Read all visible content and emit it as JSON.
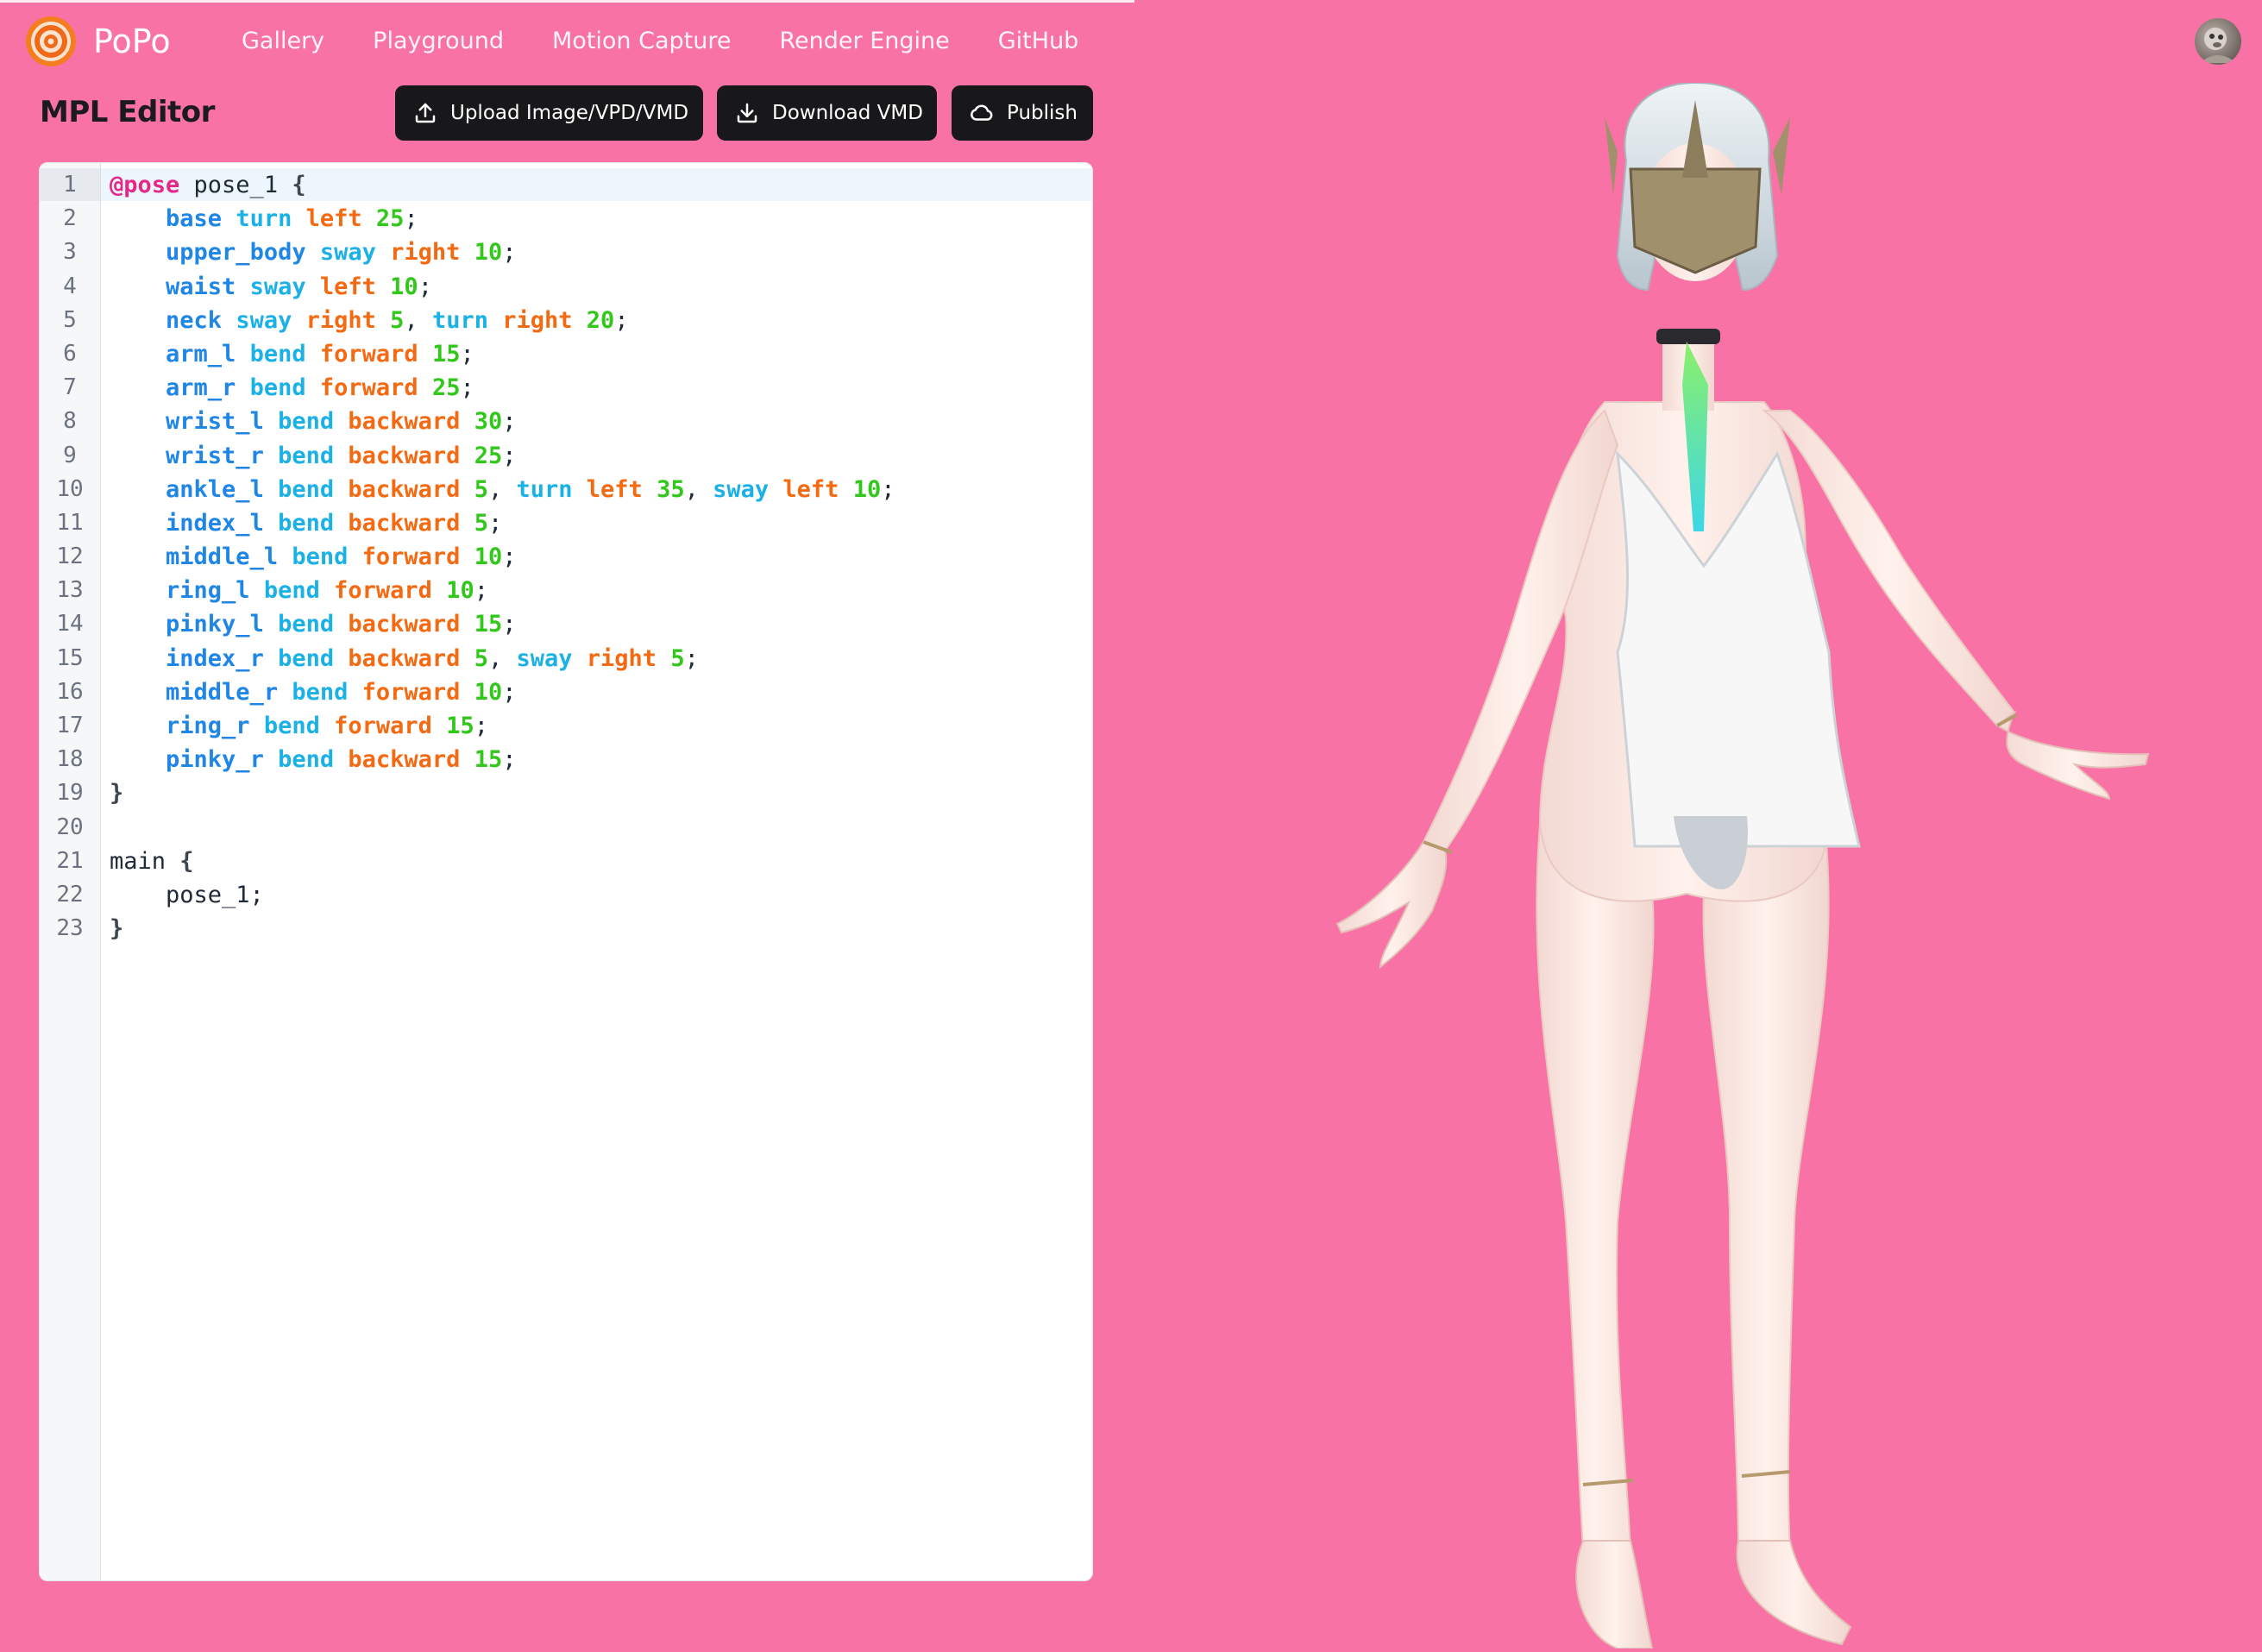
{
  "nav": {
    "brand": "PoPo",
    "links": [
      "Gallery",
      "Playground",
      "Motion Capture",
      "Render Engine",
      "GitHub"
    ]
  },
  "editor": {
    "title": "MPL Editor",
    "buttons": {
      "upload": "Upload Image/VPD/VMD",
      "download": "Download VMD",
      "publish": "Publish"
    },
    "line_numbers": [
      "1",
      "2",
      "3",
      "4",
      "5",
      "6",
      "7",
      "8",
      "9",
      "10",
      "11",
      "12",
      "13",
      "14",
      "15",
      "16",
      "17",
      "18",
      "19",
      "20",
      "21",
      "22",
      "23"
    ],
    "code_lines": [
      [
        [
          "kw-at",
          "@pose"
        ],
        [
          "plain",
          " pose_1 "
        ],
        [
          "brace",
          "{"
        ]
      ],
      [
        [
          "plain",
          "    "
        ],
        [
          "bone",
          "base"
        ],
        [
          "plain",
          " "
        ],
        [
          "act",
          "turn"
        ],
        [
          "plain",
          " "
        ],
        [
          "dir",
          "left"
        ],
        [
          "plain",
          " "
        ],
        [
          "num",
          "25"
        ],
        [
          "plain",
          ";"
        ]
      ],
      [
        [
          "plain",
          "    "
        ],
        [
          "bone",
          "upper_body"
        ],
        [
          "plain",
          " "
        ],
        [
          "act",
          "sway"
        ],
        [
          "plain",
          " "
        ],
        [
          "dir",
          "right"
        ],
        [
          "plain",
          " "
        ],
        [
          "num",
          "10"
        ],
        [
          "plain",
          ";"
        ]
      ],
      [
        [
          "plain",
          "    "
        ],
        [
          "bone",
          "waist"
        ],
        [
          "plain",
          " "
        ],
        [
          "act",
          "sway"
        ],
        [
          "plain",
          " "
        ],
        [
          "dir",
          "left"
        ],
        [
          "plain",
          " "
        ],
        [
          "num",
          "10"
        ],
        [
          "plain",
          ";"
        ]
      ],
      [
        [
          "plain",
          "    "
        ],
        [
          "bone",
          "neck"
        ],
        [
          "plain",
          " "
        ],
        [
          "act",
          "sway"
        ],
        [
          "plain",
          " "
        ],
        [
          "dir",
          "right"
        ],
        [
          "plain",
          " "
        ],
        [
          "num",
          "5"
        ],
        [
          "plain",
          ", "
        ],
        [
          "act",
          "turn"
        ],
        [
          "plain",
          " "
        ],
        [
          "dir",
          "right"
        ],
        [
          "plain",
          " "
        ],
        [
          "num",
          "20"
        ],
        [
          "plain",
          ";"
        ]
      ],
      [
        [
          "plain",
          "    "
        ],
        [
          "bone",
          "arm_l"
        ],
        [
          "plain",
          " "
        ],
        [
          "act",
          "bend"
        ],
        [
          "plain",
          " "
        ],
        [
          "dir",
          "forward"
        ],
        [
          "plain",
          " "
        ],
        [
          "num",
          "15"
        ],
        [
          "plain",
          ";"
        ]
      ],
      [
        [
          "plain",
          "    "
        ],
        [
          "bone",
          "arm_r"
        ],
        [
          "plain",
          " "
        ],
        [
          "act",
          "bend"
        ],
        [
          "plain",
          " "
        ],
        [
          "dir",
          "forward"
        ],
        [
          "plain",
          " "
        ],
        [
          "num",
          "25"
        ],
        [
          "plain",
          ";"
        ]
      ],
      [
        [
          "plain",
          "    "
        ],
        [
          "bone",
          "wrist_l"
        ],
        [
          "plain",
          " "
        ],
        [
          "act",
          "bend"
        ],
        [
          "plain",
          " "
        ],
        [
          "dir",
          "backward"
        ],
        [
          "plain",
          " "
        ],
        [
          "num",
          "30"
        ],
        [
          "plain",
          ";"
        ]
      ],
      [
        [
          "plain",
          "    "
        ],
        [
          "bone",
          "wrist_r"
        ],
        [
          "plain",
          " "
        ],
        [
          "act",
          "bend"
        ],
        [
          "plain",
          " "
        ],
        [
          "dir",
          "backward"
        ],
        [
          "plain",
          " "
        ],
        [
          "num",
          "25"
        ],
        [
          "plain",
          ";"
        ]
      ],
      [
        [
          "plain",
          "    "
        ],
        [
          "bone",
          "ankle_l"
        ],
        [
          "plain",
          " "
        ],
        [
          "act",
          "bend"
        ],
        [
          "plain",
          " "
        ],
        [
          "dir",
          "backward"
        ],
        [
          "plain",
          " "
        ],
        [
          "num",
          "5"
        ],
        [
          "plain",
          ", "
        ],
        [
          "act",
          "turn"
        ],
        [
          "plain",
          " "
        ],
        [
          "dir",
          "left"
        ],
        [
          "plain",
          " "
        ],
        [
          "num",
          "35"
        ],
        [
          "plain",
          ", "
        ],
        [
          "act",
          "sway"
        ],
        [
          "plain",
          " "
        ],
        [
          "dir",
          "left"
        ],
        [
          "plain",
          " "
        ],
        [
          "num",
          "10"
        ],
        [
          "plain",
          ";"
        ]
      ],
      [
        [
          "plain",
          "    "
        ],
        [
          "bone",
          "index_l"
        ],
        [
          "plain",
          " "
        ],
        [
          "act",
          "bend"
        ],
        [
          "plain",
          " "
        ],
        [
          "dir",
          "backward"
        ],
        [
          "plain",
          " "
        ],
        [
          "num",
          "5"
        ],
        [
          "plain",
          ";"
        ]
      ],
      [
        [
          "plain",
          "    "
        ],
        [
          "bone",
          "middle_l"
        ],
        [
          "plain",
          " "
        ],
        [
          "act",
          "bend"
        ],
        [
          "plain",
          " "
        ],
        [
          "dir",
          "forward"
        ],
        [
          "plain",
          " "
        ],
        [
          "num",
          "10"
        ],
        [
          "plain",
          ";"
        ]
      ],
      [
        [
          "plain",
          "    "
        ],
        [
          "bone",
          "ring_l"
        ],
        [
          "plain",
          " "
        ],
        [
          "act",
          "bend"
        ],
        [
          "plain",
          " "
        ],
        [
          "dir",
          "forward"
        ],
        [
          "plain",
          " "
        ],
        [
          "num",
          "10"
        ],
        [
          "plain",
          ";"
        ]
      ],
      [
        [
          "plain",
          "    "
        ],
        [
          "bone",
          "pinky_l"
        ],
        [
          "plain",
          " "
        ],
        [
          "act",
          "bend"
        ],
        [
          "plain",
          " "
        ],
        [
          "dir",
          "backward"
        ],
        [
          "plain",
          " "
        ],
        [
          "num",
          "15"
        ],
        [
          "plain",
          ";"
        ]
      ],
      [
        [
          "plain",
          "    "
        ],
        [
          "bone",
          "index_r"
        ],
        [
          "plain",
          " "
        ],
        [
          "act",
          "bend"
        ],
        [
          "plain",
          " "
        ],
        [
          "dir",
          "backward"
        ],
        [
          "plain",
          " "
        ],
        [
          "num",
          "5"
        ],
        [
          "plain",
          ", "
        ],
        [
          "act",
          "sway"
        ],
        [
          "plain",
          " "
        ],
        [
          "dir",
          "right"
        ],
        [
          "plain",
          " "
        ],
        [
          "num",
          "5"
        ],
        [
          "plain",
          ";"
        ]
      ],
      [
        [
          "plain",
          "    "
        ],
        [
          "bone",
          "middle_r"
        ],
        [
          "plain",
          " "
        ],
        [
          "act",
          "bend"
        ],
        [
          "plain",
          " "
        ],
        [
          "dir",
          "forward"
        ],
        [
          "plain",
          " "
        ],
        [
          "num",
          "10"
        ],
        [
          "plain",
          ";"
        ]
      ],
      [
        [
          "plain",
          "    "
        ],
        [
          "bone",
          "ring_r"
        ],
        [
          "plain",
          " "
        ],
        [
          "act",
          "bend"
        ],
        [
          "plain",
          " "
        ],
        [
          "dir",
          "forward"
        ],
        [
          "plain",
          " "
        ],
        [
          "num",
          "15"
        ],
        [
          "plain",
          ";"
        ]
      ],
      [
        [
          "plain",
          "    "
        ],
        [
          "bone",
          "pinky_r"
        ],
        [
          "plain",
          " "
        ],
        [
          "act",
          "bend"
        ],
        [
          "plain",
          " "
        ],
        [
          "dir",
          "backward"
        ],
        [
          "plain",
          " "
        ],
        [
          "num",
          "15"
        ],
        [
          "plain",
          ";"
        ]
      ],
      [
        [
          "brace",
          "}"
        ]
      ],
      [
        [
          "plain",
          " "
        ]
      ],
      [
        [
          "plain",
          "main "
        ],
        [
          "brace",
          "{"
        ]
      ],
      [
        [
          "plain",
          "    pose_1;"
        ]
      ],
      [
        [
          "brace",
          "}"
        ]
      ]
    ]
  },
  "icons": {
    "logo": "target-logo-icon",
    "upload": "upload-icon",
    "download": "download-icon",
    "publish": "cloud-icon",
    "avatar": "user-avatar"
  },
  "colors": {
    "background": "#f972a6",
    "button": "#18181b",
    "keyword": "#e2298a",
    "bone": "#1f86e6",
    "action": "#1cb1e6",
    "direction": "#f46a12",
    "number": "#31c71b"
  }
}
